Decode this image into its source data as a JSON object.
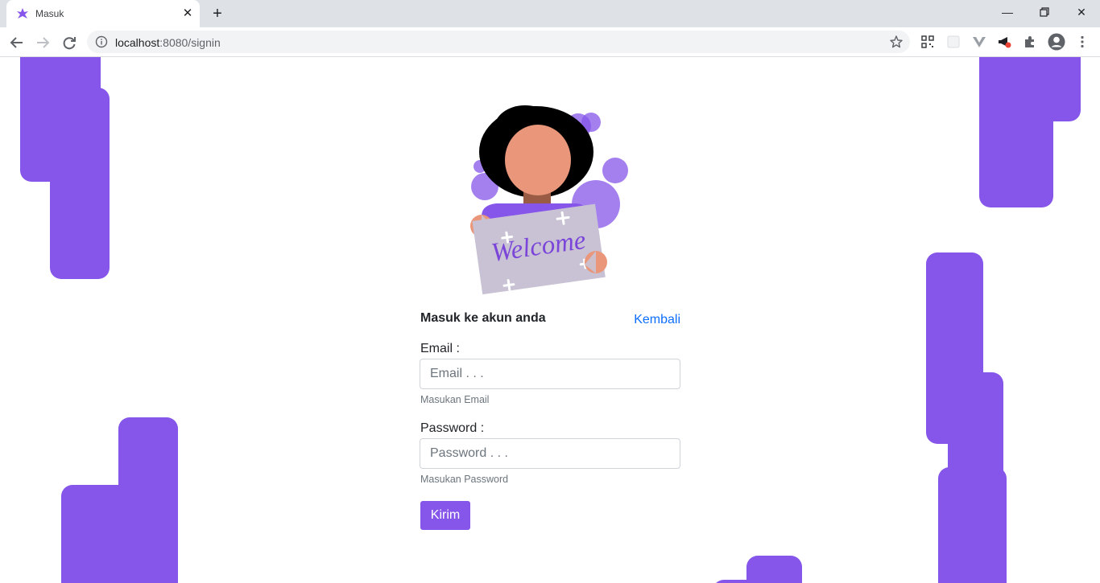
{
  "browser": {
    "tab_title": "Masuk",
    "url_host": "localhost",
    "url_rest": ":8080/signin"
  },
  "colors": {
    "accent": "#8655ea",
    "link": "#0d6efd"
  },
  "illustration": {
    "sign_text": "Welcome"
  },
  "form": {
    "title": "Masuk ke akun anda",
    "back_link": "Kembali",
    "email": {
      "label": "Email :",
      "placeholder": "Email . . .",
      "value": "",
      "help": "Masukan Email"
    },
    "password": {
      "label": "Password :",
      "placeholder": "Password . . .",
      "value": "",
      "help": "Masukan Password"
    },
    "submit_label": "Kirim"
  }
}
